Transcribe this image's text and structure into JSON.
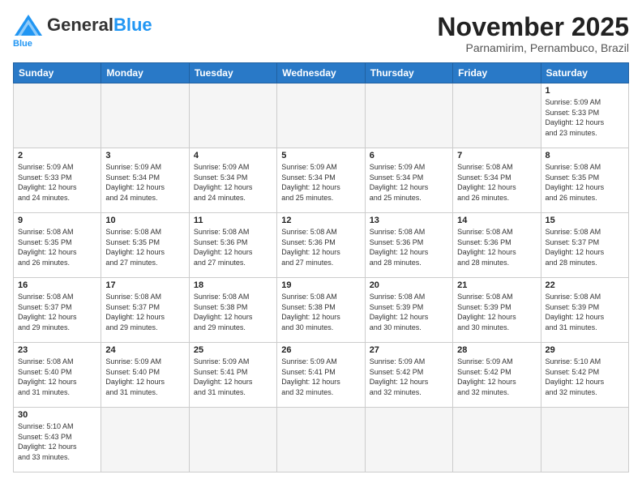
{
  "header": {
    "logo_general": "General",
    "logo_blue": "Blue",
    "month_title": "November 2025",
    "location": "Parnamirim, Pernambuco, Brazil"
  },
  "weekdays": [
    "Sunday",
    "Monday",
    "Tuesday",
    "Wednesday",
    "Thursday",
    "Friday",
    "Saturday"
  ],
  "days": [
    {
      "day": "",
      "info": ""
    },
    {
      "day": "",
      "info": ""
    },
    {
      "day": "",
      "info": ""
    },
    {
      "day": "",
      "info": ""
    },
    {
      "day": "",
      "info": ""
    },
    {
      "day": "",
      "info": ""
    },
    {
      "day": "1",
      "info": "Sunrise: 5:09 AM\nSunset: 5:33 PM\nDaylight: 12 hours\nand 23 minutes."
    },
    {
      "day": "2",
      "info": "Sunrise: 5:09 AM\nSunset: 5:33 PM\nDaylight: 12 hours\nand 24 minutes."
    },
    {
      "day": "3",
      "info": "Sunrise: 5:09 AM\nSunset: 5:34 PM\nDaylight: 12 hours\nand 24 minutes."
    },
    {
      "day": "4",
      "info": "Sunrise: 5:09 AM\nSunset: 5:34 PM\nDaylight: 12 hours\nand 24 minutes."
    },
    {
      "day": "5",
      "info": "Sunrise: 5:09 AM\nSunset: 5:34 PM\nDaylight: 12 hours\nand 25 minutes."
    },
    {
      "day": "6",
      "info": "Sunrise: 5:09 AM\nSunset: 5:34 PM\nDaylight: 12 hours\nand 25 minutes."
    },
    {
      "day": "7",
      "info": "Sunrise: 5:08 AM\nSunset: 5:34 PM\nDaylight: 12 hours\nand 26 minutes."
    },
    {
      "day": "8",
      "info": "Sunrise: 5:08 AM\nSunset: 5:35 PM\nDaylight: 12 hours\nand 26 minutes."
    },
    {
      "day": "9",
      "info": "Sunrise: 5:08 AM\nSunset: 5:35 PM\nDaylight: 12 hours\nand 26 minutes."
    },
    {
      "day": "10",
      "info": "Sunrise: 5:08 AM\nSunset: 5:35 PM\nDaylight: 12 hours\nand 27 minutes."
    },
    {
      "day": "11",
      "info": "Sunrise: 5:08 AM\nSunset: 5:36 PM\nDaylight: 12 hours\nand 27 minutes."
    },
    {
      "day": "12",
      "info": "Sunrise: 5:08 AM\nSunset: 5:36 PM\nDaylight: 12 hours\nand 27 minutes."
    },
    {
      "day": "13",
      "info": "Sunrise: 5:08 AM\nSunset: 5:36 PM\nDaylight: 12 hours\nand 28 minutes."
    },
    {
      "day": "14",
      "info": "Sunrise: 5:08 AM\nSunset: 5:36 PM\nDaylight: 12 hours\nand 28 minutes."
    },
    {
      "day": "15",
      "info": "Sunrise: 5:08 AM\nSunset: 5:37 PM\nDaylight: 12 hours\nand 28 minutes."
    },
    {
      "day": "16",
      "info": "Sunrise: 5:08 AM\nSunset: 5:37 PM\nDaylight: 12 hours\nand 29 minutes."
    },
    {
      "day": "17",
      "info": "Sunrise: 5:08 AM\nSunset: 5:37 PM\nDaylight: 12 hours\nand 29 minutes."
    },
    {
      "day": "18",
      "info": "Sunrise: 5:08 AM\nSunset: 5:38 PM\nDaylight: 12 hours\nand 29 minutes."
    },
    {
      "day": "19",
      "info": "Sunrise: 5:08 AM\nSunset: 5:38 PM\nDaylight: 12 hours\nand 30 minutes."
    },
    {
      "day": "20",
      "info": "Sunrise: 5:08 AM\nSunset: 5:39 PM\nDaylight: 12 hours\nand 30 minutes."
    },
    {
      "day": "21",
      "info": "Sunrise: 5:08 AM\nSunset: 5:39 PM\nDaylight: 12 hours\nand 30 minutes."
    },
    {
      "day": "22",
      "info": "Sunrise: 5:08 AM\nSunset: 5:39 PM\nDaylight: 12 hours\nand 31 minutes."
    },
    {
      "day": "23",
      "info": "Sunrise: 5:08 AM\nSunset: 5:40 PM\nDaylight: 12 hours\nand 31 minutes."
    },
    {
      "day": "24",
      "info": "Sunrise: 5:09 AM\nSunset: 5:40 PM\nDaylight: 12 hours\nand 31 minutes."
    },
    {
      "day": "25",
      "info": "Sunrise: 5:09 AM\nSunset: 5:41 PM\nDaylight: 12 hours\nand 31 minutes."
    },
    {
      "day": "26",
      "info": "Sunrise: 5:09 AM\nSunset: 5:41 PM\nDaylight: 12 hours\nand 32 minutes."
    },
    {
      "day": "27",
      "info": "Sunrise: 5:09 AM\nSunset: 5:42 PM\nDaylight: 12 hours\nand 32 minutes."
    },
    {
      "day": "28",
      "info": "Sunrise: 5:09 AM\nSunset: 5:42 PM\nDaylight: 12 hours\nand 32 minutes."
    },
    {
      "day": "29",
      "info": "Sunrise: 5:10 AM\nSunset: 5:42 PM\nDaylight: 12 hours\nand 32 minutes."
    },
    {
      "day": "30",
      "info": "Sunrise: 5:10 AM\nSunset: 5:43 PM\nDaylight: 12 hours\nand 33 minutes."
    }
  ]
}
